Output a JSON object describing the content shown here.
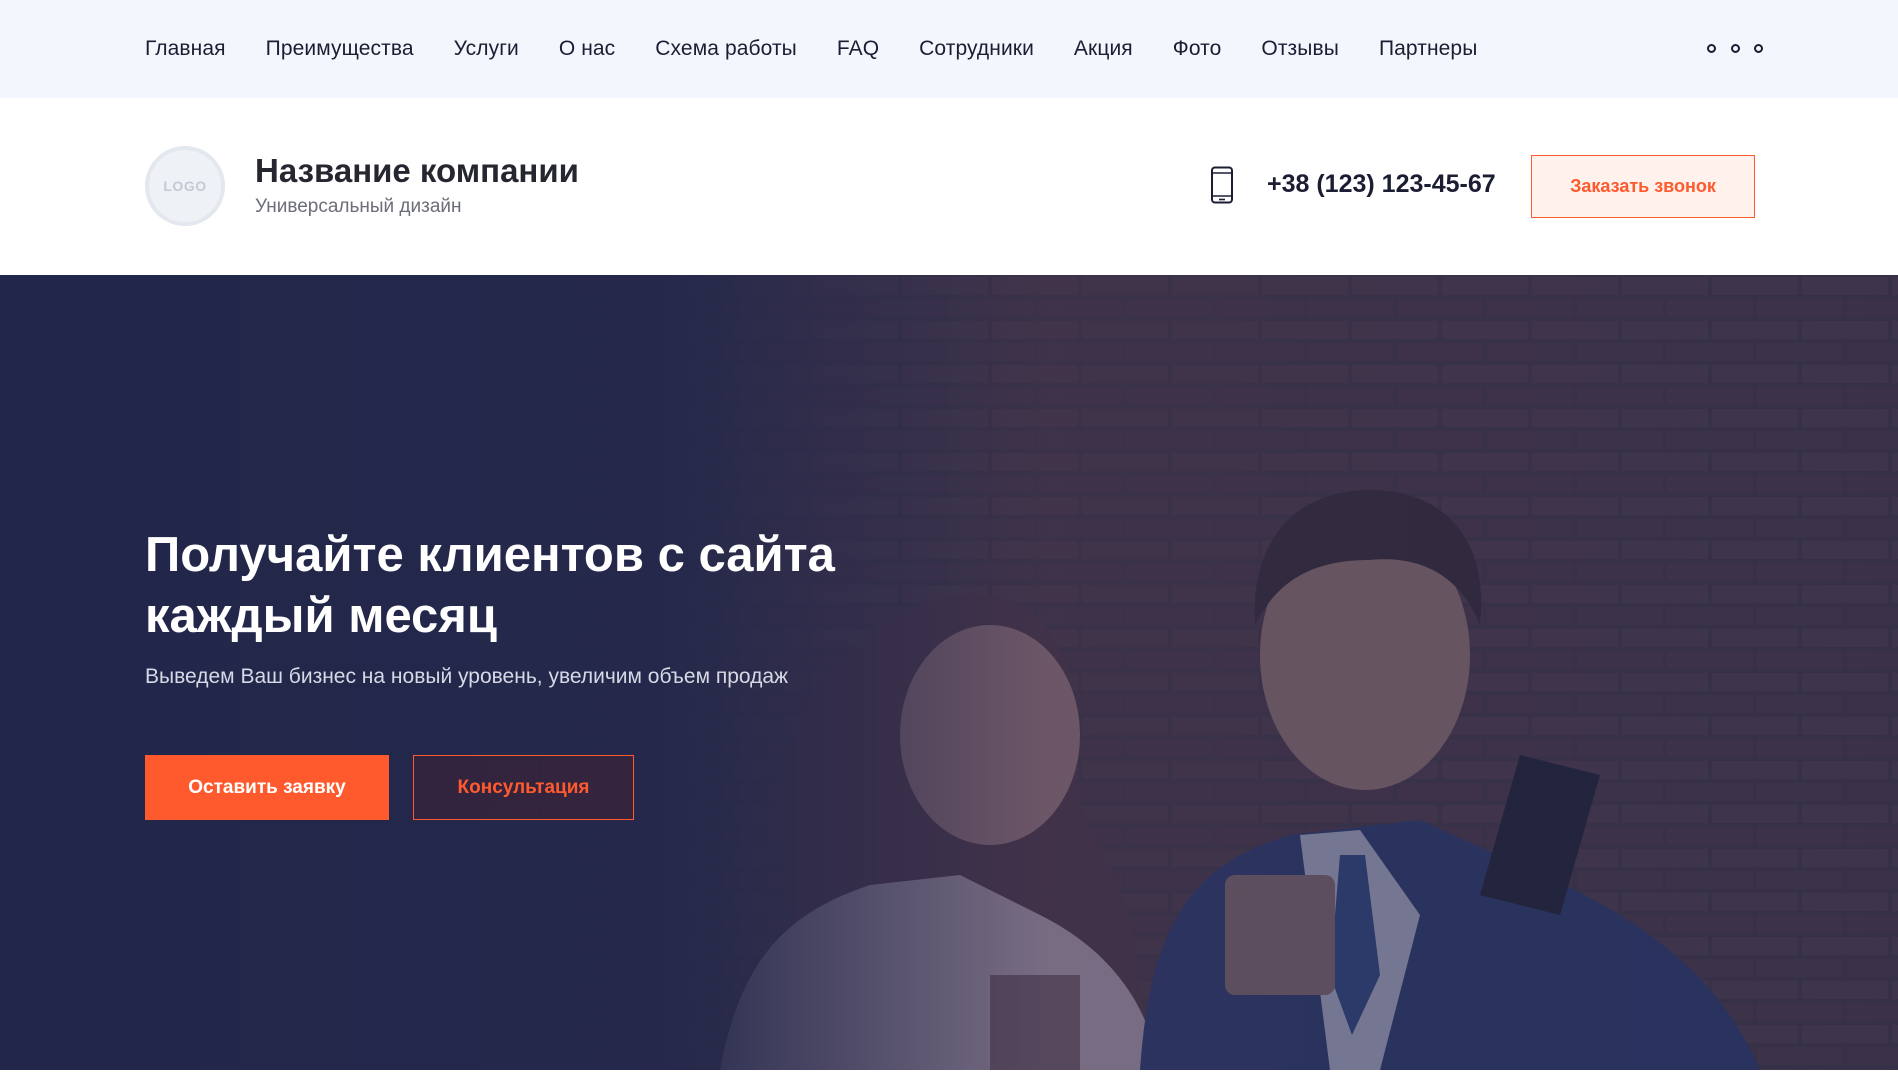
{
  "nav": {
    "items": [
      {
        "label": "Главная"
      },
      {
        "label": "Преимущества"
      },
      {
        "label": "Услуги"
      },
      {
        "label": "О нас"
      },
      {
        "label": "Схема работы"
      },
      {
        "label": "FAQ"
      },
      {
        "label": "Сотрудники"
      },
      {
        "label": "Акция"
      },
      {
        "label": "Фото"
      },
      {
        "label": "Отзывы"
      },
      {
        "label": "Партнеры"
      }
    ],
    "more_icon": "more-dots-icon"
  },
  "header": {
    "logo_text": "LOGO",
    "company_name": "Название компании",
    "company_tagline": "Универсальный дизайн",
    "phone_icon": "mobile-phone-icon",
    "phone": "+38 (123) 123-45-67",
    "callback_label": "Заказать звонок"
  },
  "hero": {
    "title": "Получайте клиентов с сайта каждый месяц",
    "subtitle": "Выведем Ваш бизнес на новый уровень, увеличим объем продаж",
    "primary_button": "Оставить заявку",
    "secondary_button": "Консультация"
  },
  "colors": {
    "accent": "#ff5a2e",
    "nav_bg": "#f3f6fc",
    "hero_overlay": "#24284b",
    "text_dark": "#1b1d33"
  }
}
